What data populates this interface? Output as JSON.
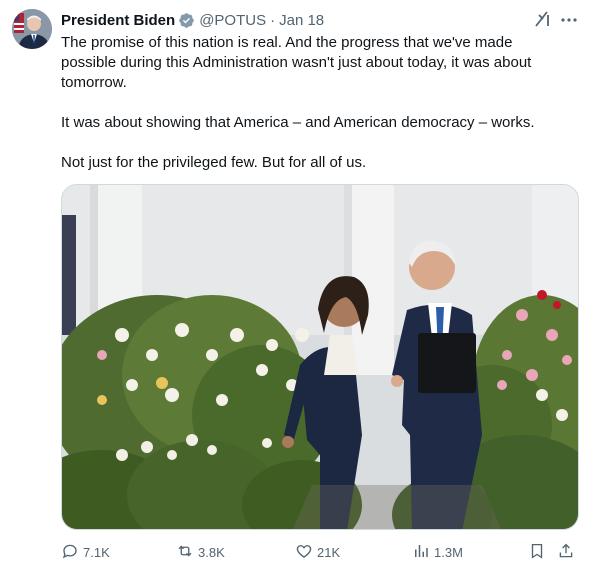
{
  "author": {
    "name": "President Biden",
    "handle": "@POTUS",
    "separator": "·",
    "date": "Jan 18"
  },
  "icons": {
    "verified": "verified-badge-icon",
    "grok": "grok-icon",
    "more": "more-icon",
    "reply": "reply-icon",
    "retweet": "retweet-icon",
    "like": "like-icon",
    "views": "views-icon",
    "bookmark": "bookmark-icon",
    "share": "share-icon"
  },
  "tweet": {
    "paragraphs": [
      "The promise of this nation is real. And the progress that we've made possible during this Administration wasn't just about today, it was about tomorrow.",
      "It was about showing that America – and American democracy – works.",
      "Not just for the privileged few. But for all of us."
    ]
  },
  "stats": {
    "replies": "7.1K",
    "retweets": "3.8K",
    "likes": "21K",
    "views": "1.3M"
  },
  "colors": {
    "text": "#0f1419",
    "secondary": "#536471",
    "verified": "#829aab",
    "border": "#cfd9de"
  }
}
